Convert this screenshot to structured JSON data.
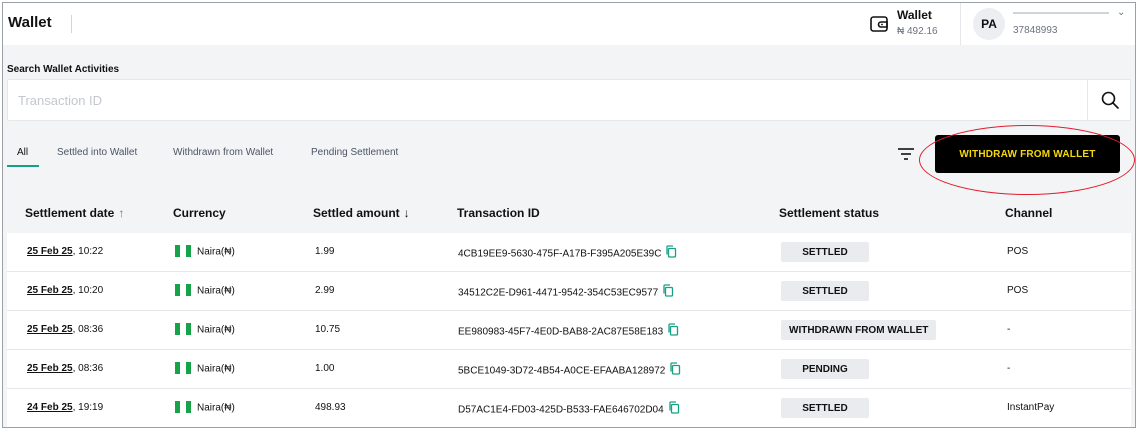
{
  "header": {
    "title": "Wallet",
    "wallet_label": "Wallet",
    "wallet_balance": "₦ 492.16",
    "user_initials": "PA",
    "user_id": "37848993"
  },
  "search": {
    "label": "Search Wallet Activities",
    "placeholder": "Transaction ID",
    "value": ""
  },
  "tabs": [
    {
      "label": "All",
      "active": true
    },
    {
      "label": "Settled into Wallet",
      "active": false
    },
    {
      "label": "Withdrawn from Wallet",
      "active": false
    },
    {
      "label": "Pending Settlement",
      "active": false
    }
  ],
  "actions": {
    "withdraw_label": "WITHDRAW FROM WALLET"
  },
  "colors": {
    "accent": "#16a085",
    "button_bg": "#000000",
    "button_text": "#f5d90a",
    "highlight": "#e11d2e",
    "flag_green": "#16a34a"
  },
  "table": {
    "columns": [
      {
        "label": "Settlement date",
        "sort": "up"
      },
      {
        "label": "Currency",
        "sort": ""
      },
      {
        "label": "Settled amount",
        "sort": "down"
      },
      {
        "label": "Transaction ID",
        "sort": ""
      },
      {
        "label": "Settlement status",
        "sort": ""
      },
      {
        "label": "Channel",
        "sort": ""
      }
    ],
    "rows": [
      {
        "date": "25 Feb 25",
        "time": ", 10:22",
        "currency": "Naira(₦)",
        "amount": "1.99",
        "txn": "4CB19EE9-5630-475F-A17B-F395A205E39C",
        "status": "SETTLED",
        "channel": "POS"
      },
      {
        "date": "25 Feb 25",
        "time": ", 10:20",
        "currency": "Naira(₦)",
        "amount": "2.99",
        "txn": "34512C2E-D961-4471-9542-354C53EC9577",
        "status": "SETTLED",
        "channel": "POS"
      },
      {
        "date": "25 Feb 25",
        "time": ", 08:36",
        "currency": "Naira(₦)",
        "amount": "10.75",
        "txn": "EE980983-45F7-4E0D-BAB8-2AC87E58E183",
        "status": "WITHDRAWN FROM WALLET",
        "channel": "-"
      },
      {
        "date": "25 Feb 25",
        "time": ", 08:36",
        "currency": "Naira(₦)",
        "amount": "1.00",
        "txn": "5BCE1049-3D72-4B54-A0CE-EFAABA128972",
        "status": "PENDING",
        "channel": "-"
      },
      {
        "date": "24 Feb 25",
        "time": ", 19:19",
        "currency": "Naira(₦)",
        "amount": "498.93",
        "txn": "D57AC1E4-FD03-425D-B533-FAE646702D04",
        "status": "SETTLED",
        "channel": "InstantPay"
      }
    ]
  }
}
